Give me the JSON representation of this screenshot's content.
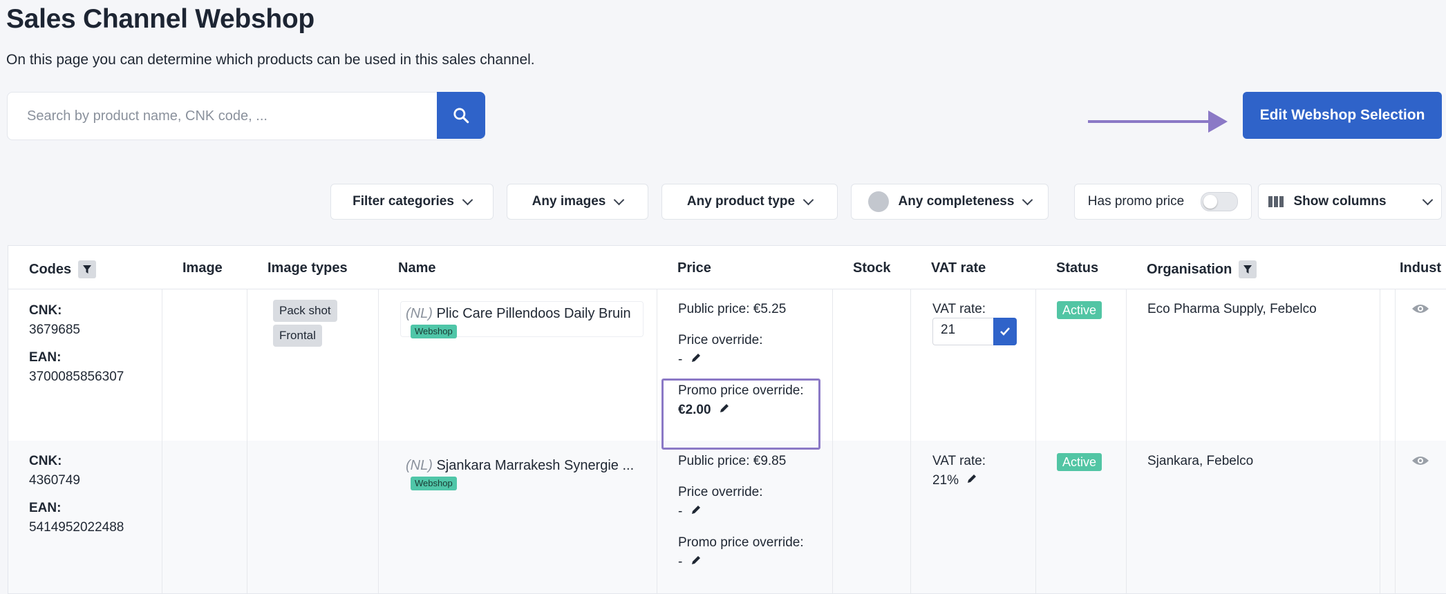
{
  "page": {
    "title": "Sales Channel Webshop",
    "subtitle": "On this page you can determine which products can be used in this sales channel."
  },
  "search": {
    "placeholder": "Search by product name, CNK code, ..."
  },
  "actions": {
    "edit_selection": "Edit Webshop Selection"
  },
  "filters": {
    "categories": "Filter categories",
    "images": "Any images",
    "product_type": "Any product type",
    "completeness": "Any completeness",
    "promo_toggle_label": "Has promo price",
    "promo_toggle_on": false,
    "show_columns": "Show columns"
  },
  "table": {
    "columns": [
      "Codes",
      "Image",
      "Image types",
      "Name",
      "Price",
      "Stock",
      "VAT rate",
      "Status",
      "Organisation",
      "Indust"
    ],
    "rows": [
      {
        "cnk_label": "CNK:",
        "cnk": "3679685",
        "ean_label": "EAN:",
        "ean": "3700085856307",
        "image_types": [
          "Pack shot",
          "Frontal"
        ],
        "lang": "(NL)",
        "name": "Plic Care Pillendoos Daily Bruin",
        "channel_tag": "Webshop",
        "public_price": "Public price: €5.25",
        "price_override_label": "Price override:",
        "price_override": "-",
        "promo_label": "Promo price override:",
        "promo_value": "€2.00",
        "vat_label": "VAT rate:",
        "vat_value": "21",
        "status": "Active",
        "organisation": "Eco Pharma Supply, Febelco"
      },
      {
        "cnk_label": "CNK:",
        "cnk": "4360749",
        "ean_label": "EAN:",
        "ean": "5414952022488",
        "image_types": [],
        "lang": "(NL)",
        "name": "Sjankara Marrakesh Synergie ...",
        "channel_tag": "Webshop",
        "public_price": "Public price: €9.85",
        "price_override_label": "Price override:",
        "price_override": "-",
        "promo_label": "Promo price override:",
        "promo_value": "-",
        "vat_label": "VAT rate:",
        "vat_value": "21%",
        "status": "Active",
        "organisation": "Sjankara, Febelco"
      }
    ]
  },
  "colors": {
    "primary": "#2f63c9",
    "active": "#52c5a4",
    "highlight": "#8b79c6"
  }
}
